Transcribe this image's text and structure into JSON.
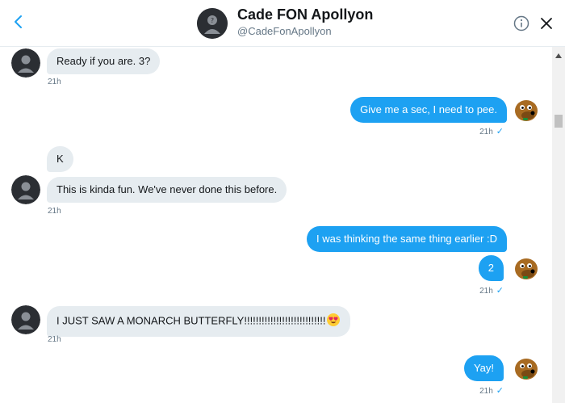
{
  "header": {
    "name": "Cade FON Apollyon",
    "handle": "@CadeFonApollyon"
  },
  "messages": [
    {
      "dir": "in",
      "text": "Ready if you are. 3?",
      "time": "21h"
    },
    {
      "dir": "out",
      "text": "Give me a sec, I need to pee.",
      "time": "21h"
    },
    {
      "dir": "in",
      "text": "K"
    },
    {
      "dir": "in",
      "text": "This is kinda fun. We've never done this before.",
      "time": "21h"
    },
    {
      "dir": "out",
      "text": "I was thinking the same thing earlier :D"
    },
    {
      "dir": "out",
      "text": "2",
      "time": "21h"
    },
    {
      "dir": "in",
      "text": "I JUST SAW A MONARCH BUTTERFLY!!!!!!!!!!!!!!!!!!!!!!!!!!!!",
      "time": "21h"
    },
    {
      "dir": "out",
      "text": "Yay!",
      "time": "21h"
    }
  ],
  "colors": {
    "outgoing_bubble": "#1da1f2",
    "incoming_bubble": "#e6ecf0"
  },
  "icons": [
    "back-arrow-icon",
    "info-icon",
    "close-icon",
    "read-check-icon",
    "heart-eyes-emoji-icon"
  ]
}
